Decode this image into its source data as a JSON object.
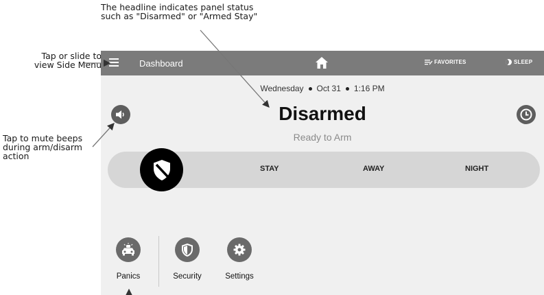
{
  "annotations": {
    "headline": "The headline indicates panel status\nsuch as \"Disarmed\" or \"Armed Stay\"",
    "menu": "Tap or slide to\nview Side Menu",
    "mute": "Tap to mute beeps\nduring arm/disarm\naction"
  },
  "topbar": {
    "title": "Dashboard",
    "favorites_label": "FAVORITES",
    "sleep_label": "SLEEP"
  },
  "dateline": {
    "day": "Wednesday",
    "date": "Oct 31",
    "time": "1:16 PM"
  },
  "status": {
    "headline": "Disarmed",
    "subtext": "Ready to Arm"
  },
  "arm_bar": {
    "options": [
      "STAY",
      "AWAY",
      "NIGHT"
    ]
  },
  "shortcuts": {
    "panics": "Panics",
    "security": "Security",
    "settings": "Settings"
  },
  "icons": {
    "menu": "hamburger-icon",
    "home": "home-icon",
    "favorites": "favorites-icon",
    "sleep": "moon-icon",
    "mute": "speaker-icon",
    "clock": "clock-icon",
    "disarm": "shield-slash-icon",
    "panics": "siren-car-icon",
    "security": "shield-icon",
    "settings": "gear-icon"
  },
  "colors": {
    "topbar": "#7b7b7b",
    "screen_bg": "#f0f0f0",
    "arm_bar": "#d6d6d6",
    "disarm_knob": "#000000",
    "button_gray": "#5e5e5e"
  }
}
